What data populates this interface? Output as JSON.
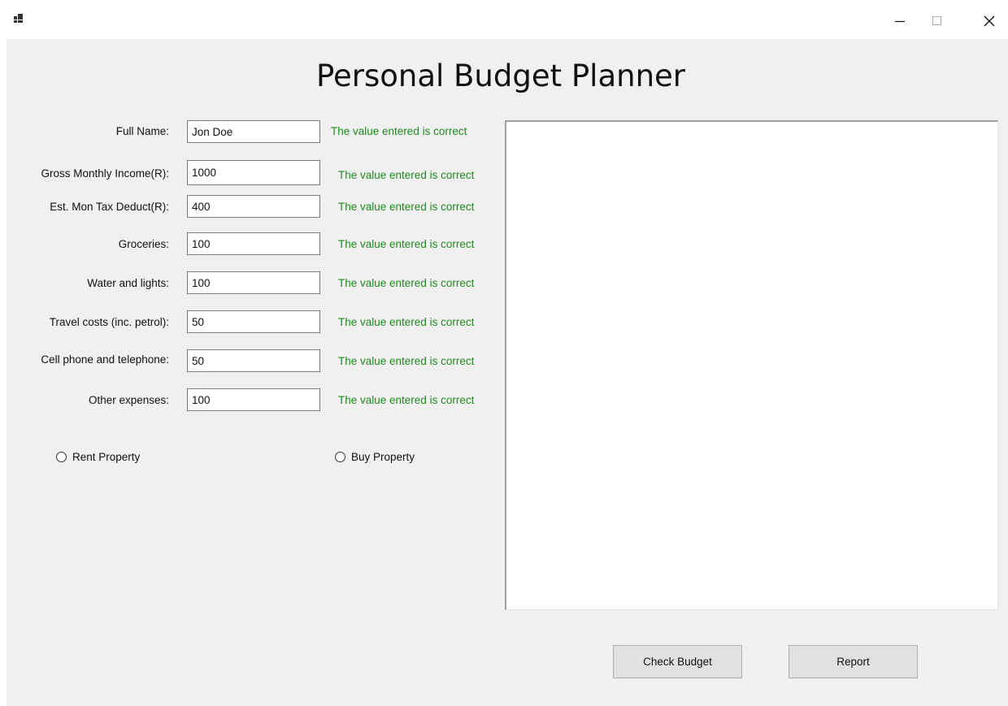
{
  "window": {
    "title": "Personal Budget Planner",
    "controls": {
      "minimize_icon": "minimize-icon",
      "maximize_icon": "maximize-icon",
      "close_icon": "close-icon"
    }
  },
  "form": {
    "fields": [
      {
        "label": "Full Name:",
        "value": "Jon Doe",
        "status": "The value entered is correct"
      },
      {
        "label": "Gross Monthly Income(R):",
        "value": "1000",
        "status": "The value entered is correct"
      },
      {
        "label": "Est. Mon Tax Deduct(R):",
        "value": "400",
        "status": "The value entered is correct"
      },
      {
        "label": "Groceries:",
        "value": "100",
        "status": "The value entered is correct"
      },
      {
        "label": "Water and lights:",
        "value": "100",
        "status": "The value entered is correct"
      },
      {
        "label": "Travel costs (inc. petrol):",
        "value": "50",
        "status": "The value entered is correct"
      },
      {
        "label": "Cell phone and telephone:",
        "value": "50",
        "status": "The value entered is correct"
      },
      {
        "label": "Other expenses:",
        "value": "100",
        "status": "The value entered is correct"
      }
    ],
    "radios": {
      "rent": "Rent Property",
      "buy": "Buy Property"
    }
  },
  "output": {
    "text": ""
  },
  "buttons": {
    "check_budget": "Check Budget",
    "report": "Report"
  },
  "colors": {
    "valid_text": "#1d8a1d",
    "window_bg": "#f0f0f0",
    "button_bg": "#e1e1e1"
  }
}
